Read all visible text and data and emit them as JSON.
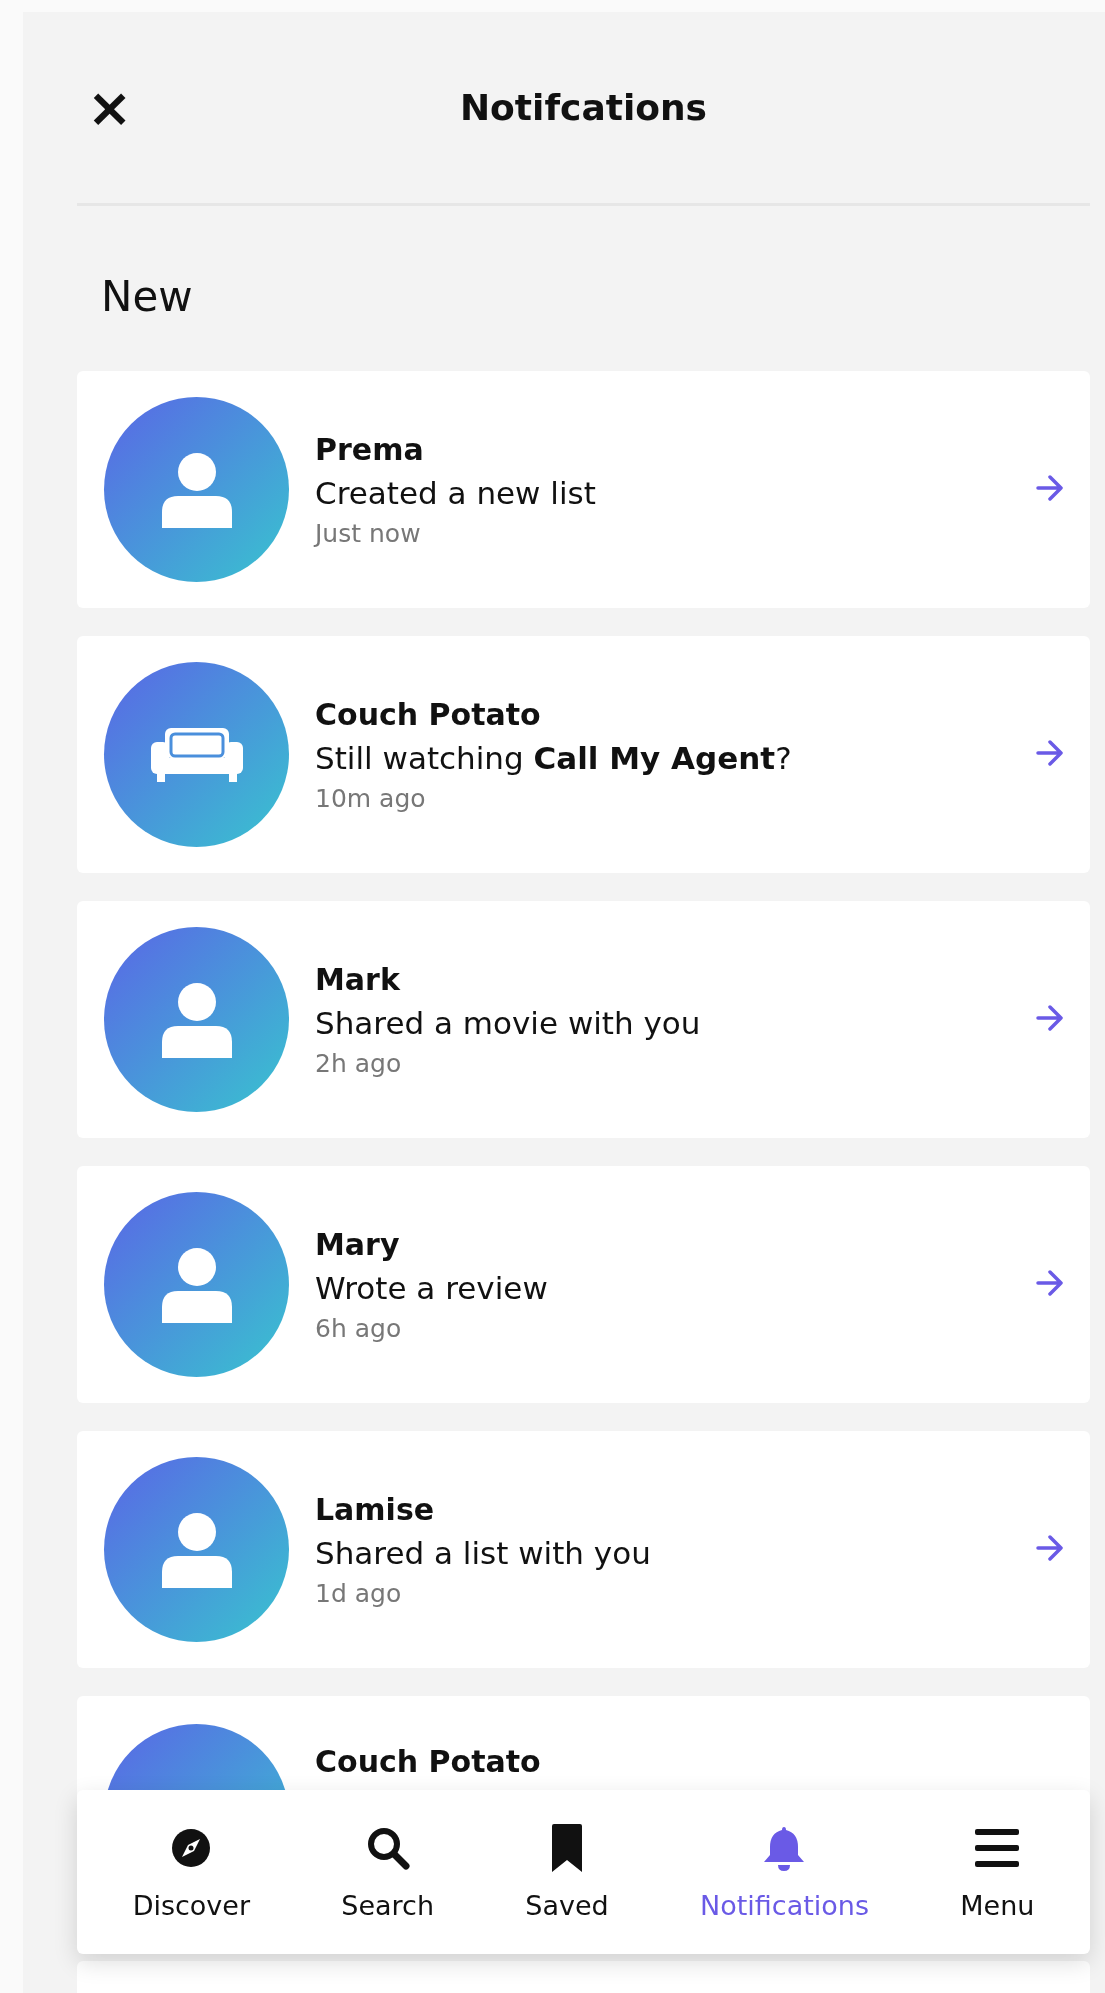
{
  "header": {
    "close_icon": "×",
    "title": "Notifcations"
  },
  "section_title": "New",
  "notifications": [
    {
      "kind": "person",
      "name": "Prema",
      "message": "Created a new list",
      "time": "Just now"
    },
    {
      "kind": "couch",
      "name": "Couch Potato",
      "message": "Still watching **Call My Agent**?",
      "time": "10m ago"
    },
    {
      "kind": "person",
      "name": "Mark",
      "message": "Shared a movie with you",
      "time": "2h ago"
    },
    {
      "kind": "person",
      "name": "Mary",
      "message": "Wrote a review",
      "time": "6h ago"
    },
    {
      "kind": "person",
      "name": "Lamise",
      "message": "Shared a list with you",
      "time": "1d ago"
    },
    {
      "name": "Couch Potato"
    }
  ],
  "bottom_nav": [
    {
      "kind": "compass",
      "label": "Discover",
      "selected": false
    },
    {
      "kind": "search",
      "label": "Search",
      "selected": false
    },
    {
      "kind": "bookmark",
      "label": "Saved",
      "selected": false
    },
    {
      "kind": "bell",
      "label": "Notifications",
      "selected": true
    },
    {
      "kind": "menu",
      "label": "Menu",
      "selected": false
    }
  ]
}
